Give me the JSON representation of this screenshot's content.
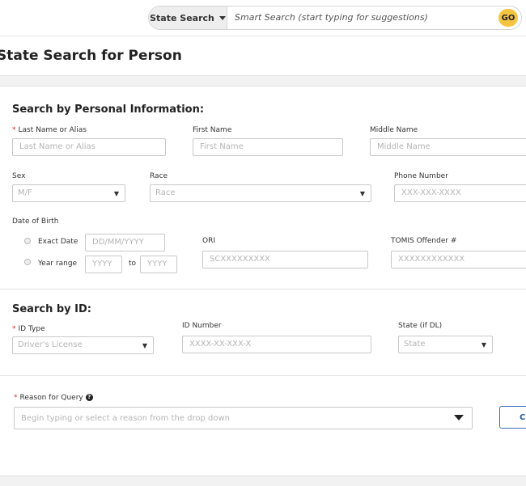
{
  "topbar": {
    "scope_label": "State Search",
    "search_placeholder": "Smart Search (start typing for suggestions)",
    "go_label": "GO"
  },
  "page": {
    "title": "State Search for Person"
  },
  "personal": {
    "section_title": "Search by Personal Information:",
    "last_name": {
      "label": "Last Name or Alias",
      "placeholder": "Last Name or Alias",
      "required": "*"
    },
    "first_name": {
      "label": "First Name",
      "placeholder": "First Name"
    },
    "middle_name": {
      "label": "Middle Name",
      "placeholder": "Middle Name"
    },
    "sex": {
      "label": "Sex",
      "value": "M/F"
    },
    "race": {
      "label": "Race",
      "value": "Race"
    },
    "phone": {
      "label": "Phone Number",
      "placeholder": "XXX-XXX-XXXX"
    },
    "dob": {
      "label": "Date of Birth",
      "exact_label": "Exact Date",
      "exact_placeholder": "DD/MM/YYYY",
      "range_label": "Year range",
      "range_from_placeholder": "YYYY",
      "range_to_label": "to",
      "range_to_placeholder": "YYYY"
    },
    "ori": {
      "label": "ORI",
      "placeholder": "SCXXXXXXXXX"
    },
    "tomis": {
      "label": "TOMIS Offender #",
      "placeholder": "XXXXXXXXXXXX"
    }
  },
  "id_search": {
    "section_title": "Search by ID:",
    "id_type": {
      "label": "ID Type",
      "value": "Driver's License",
      "required": "*"
    },
    "id_number": {
      "label": "ID Number",
      "placeholder": "XXXX-XX-XXX-X"
    },
    "state": {
      "label": "State (if DL)",
      "value": "State"
    }
  },
  "reason": {
    "label": "Reason for Query",
    "required": "*",
    "help_icon": "?",
    "placeholder": "Begin typing or select a reason from the drop down",
    "button_label": "C"
  }
}
